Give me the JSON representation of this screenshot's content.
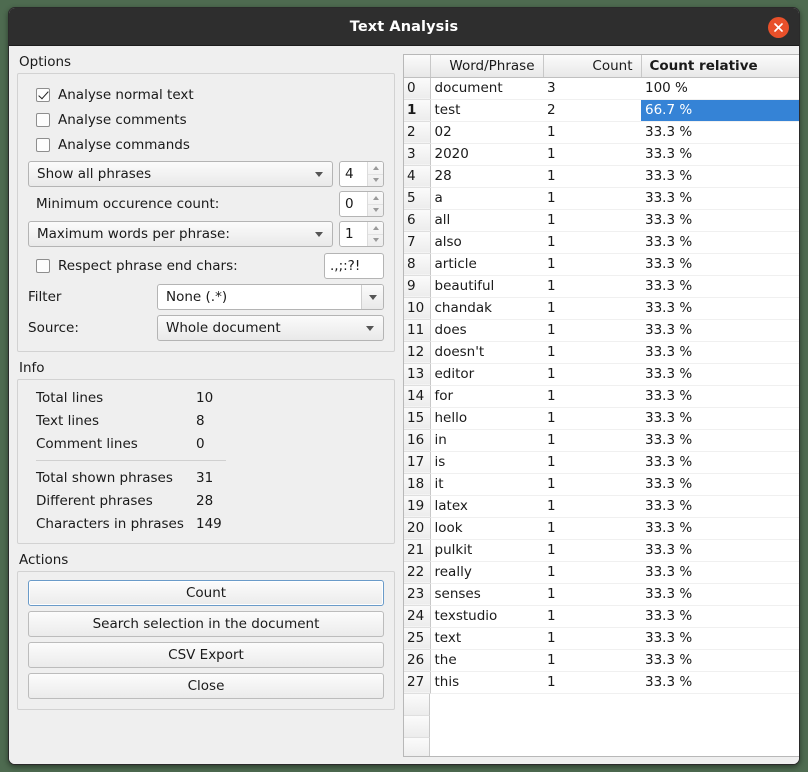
{
  "window": {
    "title": "Text Analysis",
    "close_icon": "close-icon",
    "accent_close": "#e8502a",
    "selection_color": "#3583d6"
  },
  "options": {
    "legend": "Options",
    "checkboxes": [
      {
        "label": "Analyse normal text",
        "checked": true
      },
      {
        "label": "Analyse comments",
        "checked": false
      },
      {
        "label": "Analyse commands",
        "checked": false
      }
    ],
    "phrase_mode": {
      "value": "Show all phrases",
      "spin": "4"
    },
    "min_occurence": {
      "label": "Minimum occurence count:",
      "spin": "0"
    },
    "max_words": {
      "value": "Maximum words per phrase:",
      "spin": "1"
    },
    "end_chars": {
      "label": "Respect phrase end chars:",
      "checked": false,
      "value": ".,;:?!"
    },
    "filter": {
      "label": "Filter",
      "value": "None (.*)"
    },
    "source": {
      "label": "Source:",
      "value": "Whole document"
    }
  },
  "info": {
    "legend": "Info",
    "rows_top": [
      {
        "name": "Total lines",
        "value": "10"
      },
      {
        "name": "Text lines",
        "value": "8"
      },
      {
        "name": "Comment lines",
        "value": "0"
      }
    ],
    "rows_bottom": [
      {
        "name": "Total shown phrases",
        "value": "31"
      },
      {
        "name": "Different phrases",
        "value": "28"
      },
      {
        "name": "Characters in phrases",
        "value": "149"
      }
    ]
  },
  "actions": {
    "legend": "Actions",
    "buttons": [
      {
        "label": "Count",
        "default": true
      },
      {
        "label": "Search selection in the document",
        "default": false
      },
      {
        "label": "CSV Export",
        "default": false
      },
      {
        "label": "Close",
        "default": false
      }
    ]
  },
  "table": {
    "headers": {
      "corner": "",
      "word": "Word/Phrase",
      "count": "Count",
      "relative": "Count relative"
    },
    "selected_row": 1,
    "rows": [
      {
        "idx": "0",
        "word": "document",
        "count": "3",
        "relative": "100 %"
      },
      {
        "idx": "1",
        "word": "test",
        "count": "2",
        "relative": "66.7 %"
      },
      {
        "idx": "2",
        "word": "02",
        "count": "1",
        "relative": "33.3 %"
      },
      {
        "idx": "3",
        "word": "2020",
        "count": "1",
        "relative": "33.3 %"
      },
      {
        "idx": "4",
        "word": "28",
        "count": "1",
        "relative": "33.3 %"
      },
      {
        "idx": "5",
        "word": "a",
        "count": "1",
        "relative": "33.3 %"
      },
      {
        "idx": "6",
        "word": "all",
        "count": "1",
        "relative": "33.3 %"
      },
      {
        "idx": "7",
        "word": "also",
        "count": "1",
        "relative": "33.3 %"
      },
      {
        "idx": "8",
        "word": "article",
        "count": "1",
        "relative": "33.3 %"
      },
      {
        "idx": "9",
        "word": "beautiful",
        "count": "1",
        "relative": "33.3 %"
      },
      {
        "idx": "10",
        "word": "chandak",
        "count": "1",
        "relative": "33.3 %"
      },
      {
        "idx": "11",
        "word": "does",
        "count": "1",
        "relative": "33.3 %"
      },
      {
        "idx": "12",
        "word": "doesn't",
        "count": "1",
        "relative": "33.3 %"
      },
      {
        "idx": "13",
        "word": "editor",
        "count": "1",
        "relative": "33.3 %"
      },
      {
        "idx": "14",
        "word": "for",
        "count": "1",
        "relative": "33.3 %"
      },
      {
        "idx": "15",
        "word": "hello",
        "count": "1",
        "relative": "33.3 %"
      },
      {
        "idx": "16",
        "word": "in",
        "count": "1",
        "relative": "33.3 %"
      },
      {
        "idx": "17",
        "word": "is",
        "count": "1",
        "relative": "33.3 %"
      },
      {
        "idx": "18",
        "word": "it",
        "count": "1",
        "relative": "33.3 %"
      },
      {
        "idx": "19",
        "word": "latex",
        "count": "1",
        "relative": "33.3 %"
      },
      {
        "idx": "20",
        "word": "look",
        "count": "1",
        "relative": "33.3 %"
      },
      {
        "idx": "21",
        "word": "pulkit",
        "count": "1",
        "relative": "33.3 %"
      },
      {
        "idx": "22",
        "word": "really",
        "count": "1",
        "relative": "33.3 %"
      },
      {
        "idx": "23",
        "word": "senses",
        "count": "1",
        "relative": "33.3 %"
      },
      {
        "idx": "24",
        "word": "texstudio",
        "count": "1",
        "relative": "33.3 %"
      },
      {
        "idx": "25",
        "word": "text",
        "count": "1",
        "relative": "33.3 %"
      },
      {
        "idx": "26",
        "word": "the",
        "count": "1",
        "relative": "33.3 %"
      },
      {
        "idx": "27",
        "word": "this",
        "count": "1",
        "relative": "33.3 %"
      }
    ]
  }
}
